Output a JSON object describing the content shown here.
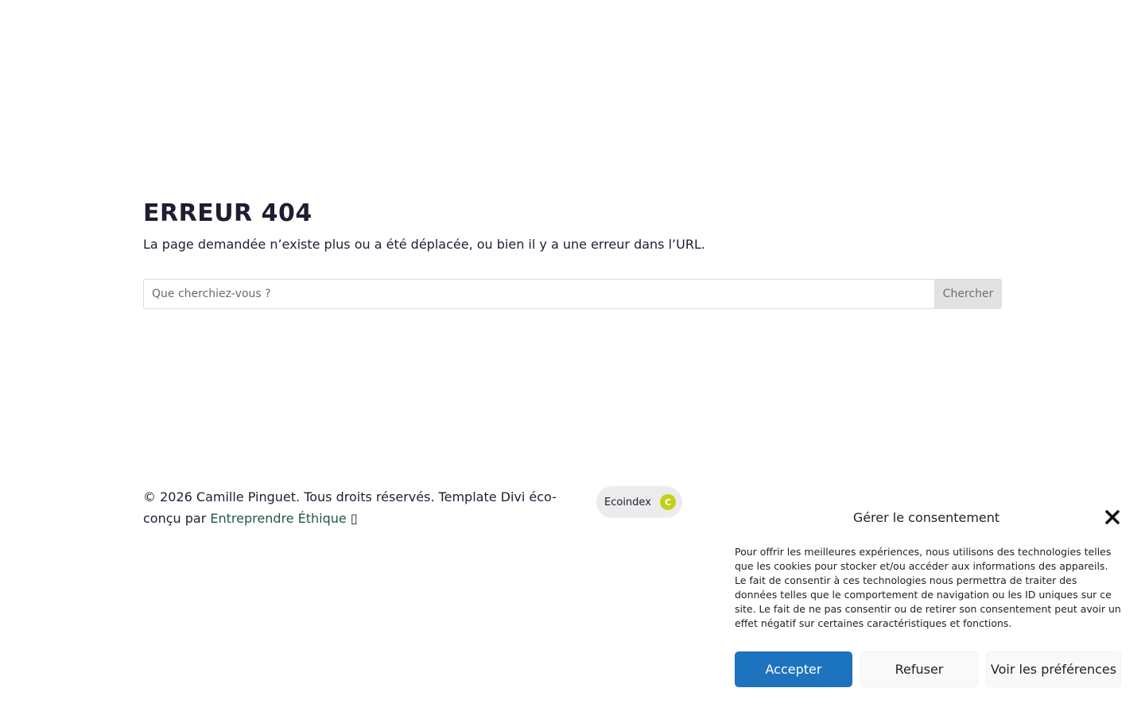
{
  "error": {
    "title": "ERREUR 404",
    "message": "La page demandée n’existe plus ou a été déplacée, ou bien il y a une erreur dans l’URL."
  },
  "search": {
    "placeholder": "Que cherchiez-vous ?",
    "value": "",
    "button_label": "Chercher"
  },
  "footer": {
    "copyright_prefix": "© 2026 Camille Pinguet. Tous droits réservés. Template Divi éco-conçu par ",
    "link_label": "Entreprendre Éthique",
    "link_suffix": " ▯",
    "ecoindex": {
      "label": "Ecoindex",
      "grade": "C",
      "grade_color": "#c3cf19"
    }
  },
  "consent": {
    "title": "Gérer le consentement",
    "close_icon": "close-icon",
    "body": "Pour offrir les meilleures expériences, nous utilisons des technologies telles que les cookies pour stocker et/ou accéder aux informations des appareils. Le fait de consentir à ces technologies nous permettra de traiter des données telles que le comportement de navigation ou les ID uniques sur ce site. Le fait de ne pas consentir ou de retirer son consentement peut avoir un effet négatif sur certaines caractéristiques et fonctions.",
    "accept_label": "Accepter",
    "refuse_label": "Refuser",
    "preferences_label": "Voir les préférences",
    "accent_color": "#1e73be"
  }
}
